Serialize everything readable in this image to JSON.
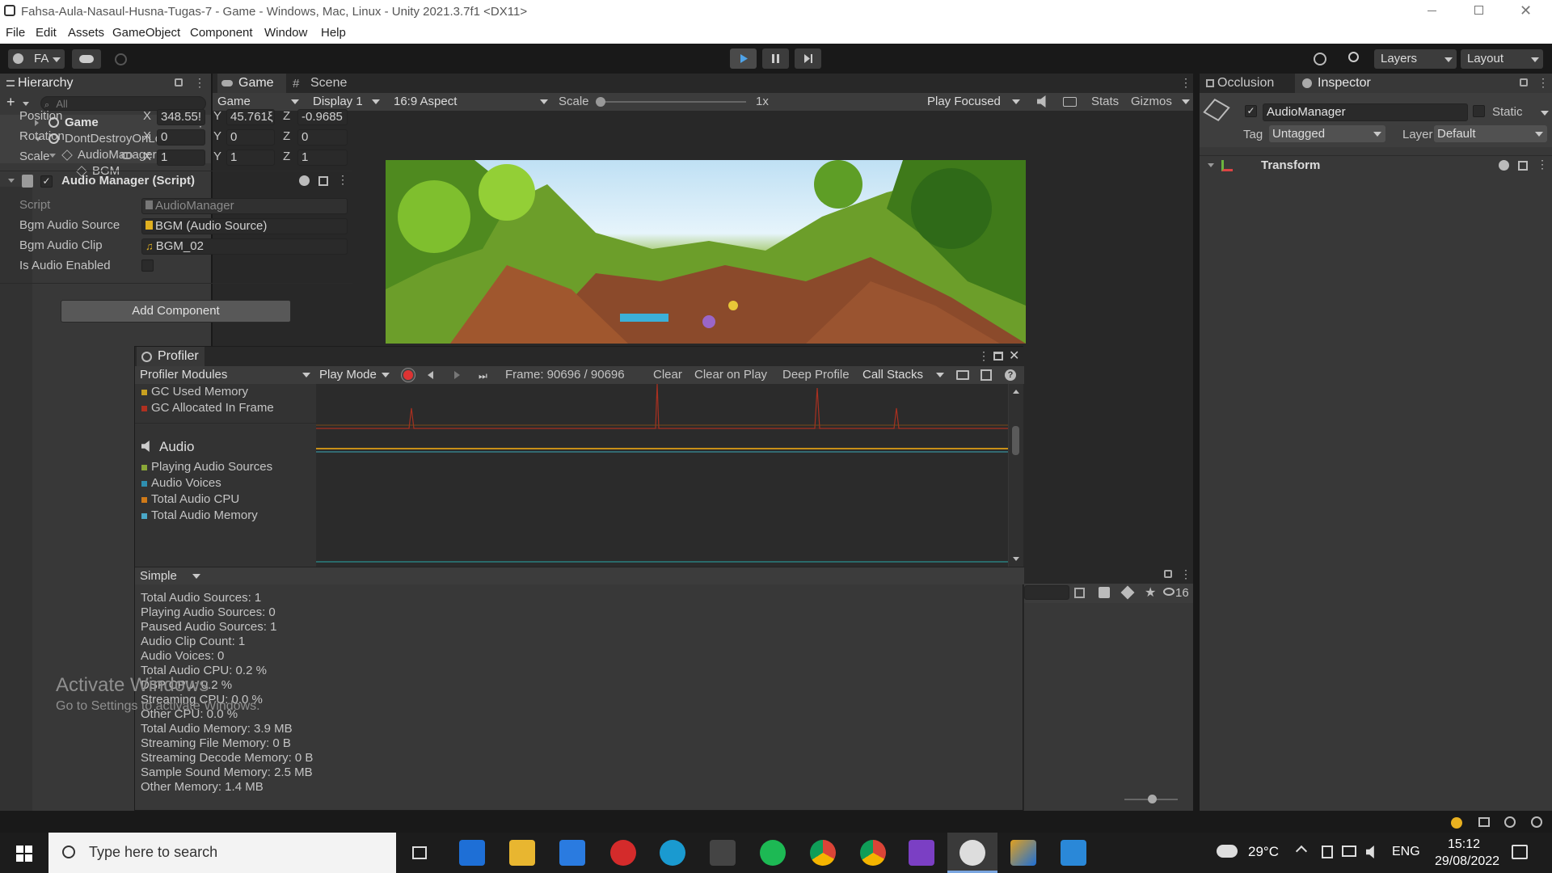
{
  "window": {
    "title": "Fahsa-Aula-Nasaul-Husna-Tugas-7 - Game - Windows, Mac, Linux - Unity 2021.3.7f1 <DX11>"
  },
  "menu": [
    "File",
    "Edit",
    "Assets",
    "GameObject",
    "Component",
    "Window",
    "Help"
  ],
  "toolbar": {
    "account": "FA",
    "layers": "Layers",
    "layout": "Layout"
  },
  "hierarchy": {
    "tab": "Hierarchy",
    "search_placeholder": "All",
    "items": [
      "Game",
      "DontDestroyOnLoad",
      "AudioManager",
      "BGM"
    ]
  },
  "game_view": {
    "tabs": [
      "Game",
      "Scene"
    ],
    "mode": "Game",
    "display": "Display 1",
    "aspect": "16:9 Aspect",
    "scale_label": "Scale",
    "scale_value": "1x",
    "play_focused": "Play Focused",
    "stats": "Stats",
    "gizmos": "Gizmos"
  },
  "profiler": {
    "tab": "Profiler",
    "modules_label": "Profiler Modules",
    "play_mode": "Play Mode",
    "frame": "Frame: 90696 / 90696",
    "clear": "Clear",
    "clear_on_play": "Clear on Play",
    "deep_profile": "Deep Profile",
    "call_stacks": "Call Stacks",
    "memory_legend": [
      {
        "label": "GC Used Memory",
        "color": "#c8a020"
      },
      {
        "label": "GC Allocated In Frame",
        "color": "#b03020"
      }
    ],
    "audio_title": "Audio",
    "audio_legend": [
      {
        "label": "Playing Audio Sources",
        "color": "#8aa838"
      },
      {
        "label": "Audio Voices",
        "color": "#2f8fb0"
      },
      {
        "label": "Total Audio CPU",
        "color": "#d07a18"
      },
      {
        "label": "Total Audio Memory",
        "color": "#4aa8c8"
      }
    ],
    "view_mode": "Simple",
    "stats": [
      "Total Audio Sources: 1",
      "Playing Audio Sources: 0",
      "Paused Audio Sources: 1",
      "Audio Clip Count: 1",
      "Audio Voices: 0",
      "Total Audio CPU: 0.2 %",
      "DSP CPU: 0.2 %",
      "Streaming CPU: 0.0 %",
      "Other CPU: 0.0 %",
      "Total Audio Memory: 3.9 MB",
      "Streaming File Memory: 0 B",
      "Streaming Decode Memory: 0 B",
      "Sample Sound Memory: 2.5 MB",
      "Other Memory: 1.4 MB"
    ]
  },
  "project": {
    "badge_count": "16"
  },
  "inspector": {
    "tabs": [
      "Occlusion",
      "Inspector"
    ],
    "object_name": "AudioManager",
    "static_label": "Static",
    "tag_label": "Tag",
    "tag_value": "Untagged",
    "layer_label": "Layer",
    "layer_value": "Default",
    "transform": {
      "title": "Transform",
      "position": {
        "label": "Position",
        "x": "348.55!",
        "y": "45.761ξ",
        "z": "-0.9685"
      },
      "rotation": {
        "label": "Rotation",
        "x": "0",
        "y": "0",
        "z": "0"
      },
      "scale": {
        "label": "Scale",
        "x": "1",
        "y": "1",
        "z": "1"
      }
    },
    "script_component": {
      "title": "Audio Manager (Script)",
      "script_label": "Script",
      "script_value": "AudioManager",
      "bgm_source_label": "Bgm Audio Source",
      "bgm_source_value": "BGM (Audio Source)",
      "bgm_clip_label": "Bgm Audio Clip",
      "bgm_clip_value": "BGM_02",
      "enabled_label": "Is Audio Enabled"
    },
    "add_component": "Add Component"
  },
  "watermark": {
    "title": "Activate Windows",
    "subtitle": "Go to Settings to activate Windows."
  },
  "taskbar": {
    "search_placeholder": "Type here to search",
    "weather": "29°C",
    "language": "ENG",
    "time": "15:12",
    "date": "29/08/2022"
  }
}
